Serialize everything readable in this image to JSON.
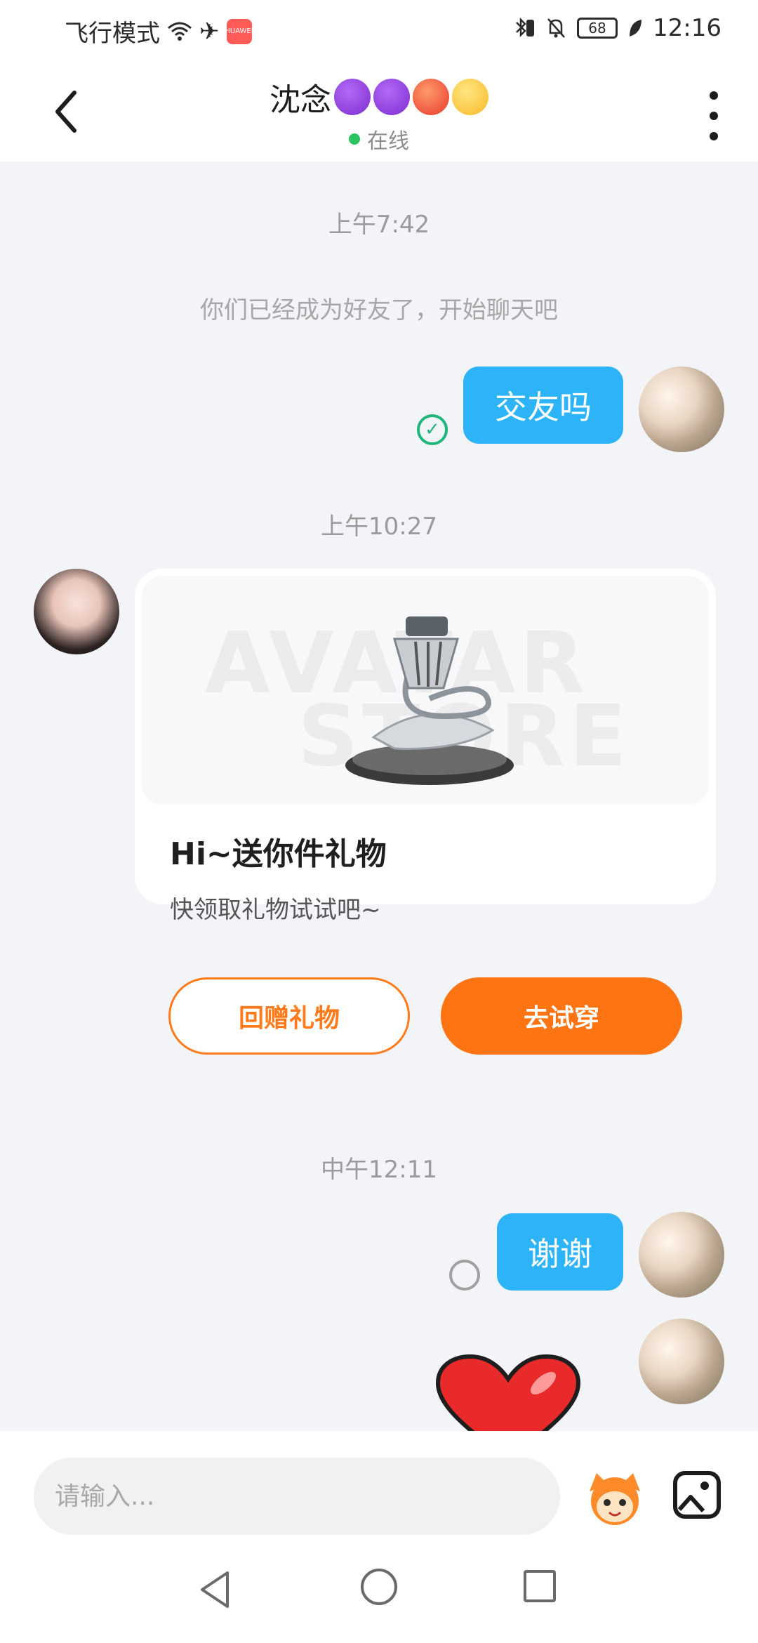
{
  "status_bar": {
    "left_text": "飞行模式",
    "app_badge": "HUAWEI",
    "battery": "68",
    "time": "12:16"
  },
  "header": {
    "contact_name": "沈念",
    "emoji_names": [
      "devil-icon",
      "devil-icon",
      "angry-face-icon",
      "grinning-face-icon"
    ],
    "status": "在线"
  },
  "chat": {
    "timestamps": [
      "上午7:42",
      "上午10:27",
      "中午12:11"
    ],
    "system_message": "你们已经成为好友了，开始聊天吧",
    "messages": [
      {
        "sender": "me",
        "text": "交友吗",
        "status": "read"
      },
      {
        "sender": "me",
        "text": "谢谢",
        "status": "pending"
      }
    ],
    "gift_card": {
      "title": "Hi~送你件礼物",
      "subtitle": "快领取礼物试试吧~",
      "watermark_line1": "AVATAR",
      "watermark_line2": "STORE",
      "return_gift_label": "回赠礼物",
      "try_on_label": "去试穿"
    }
  },
  "input_bar": {
    "placeholder": "请输入..."
  },
  "colors": {
    "bubble_blue": "#2db4f8",
    "accent_orange": "#ff7412",
    "online_green": "#2ac560",
    "background": "#f3f4f8"
  }
}
